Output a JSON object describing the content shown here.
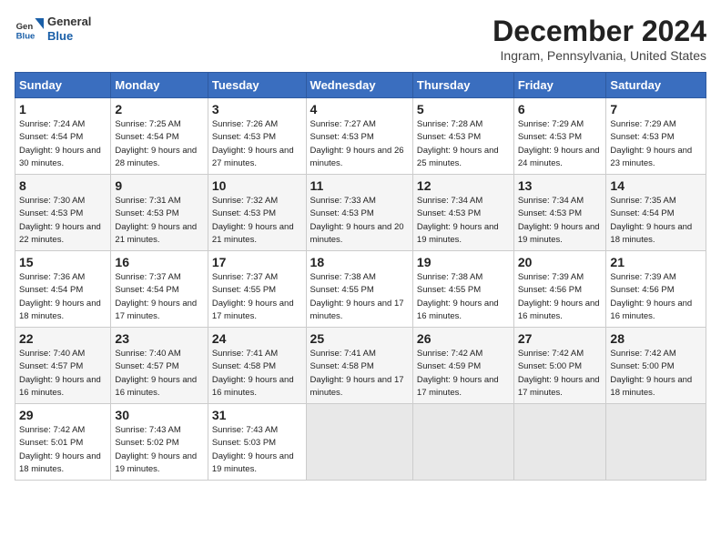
{
  "header": {
    "logo_line1": "General",
    "logo_line2": "Blue",
    "month_title": "December 2024",
    "location": "Ingram, Pennsylvania, United States"
  },
  "weekdays": [
    "Sunday",
    "Monday",
    "Tuesday",
    "Wednesday",
    "Thursday",
    "Friday",
    "Saturday"
  ],
  "weeks": [
    [
      {
        "day": "1",
        "sunrise": "7:24 AM",
        "sunset": "4:54 PM",
        "daylight": "9 hours and 30 minutes."
      },
      {
        "day": "2",
        "sunrise": "7:25 AM",
        "sunset": "4:54 PM",
        "daylight": "9 hours and 28 minutes."
      },
      {
        "day": "3",
        "sunrise": "7:26 AM",
        "sunset": "4:53 PM",
        "daylight": "9 hours and 27 minutes."
      },
      {
        "day": "4",
        "sunrise": "7:27 AM",
        "sunset": "4:53 PM",
        "daylight": "9 hours and 26 minutes."
      },
      {
        "day": "5",
        "sunrise": "7:28 AM",
        "sunset": "4:53 PM",
        "daylight": "9 hours and 25 minutes."
      },
      {
        "day": "6",
        "sunrise": "7:29 AM",
        "sunset": "4:53 PM",
        "daylight": "9 hours and 24 minutes."
      },
      {
        "day": "7",
        "sunrise": "7:29 AM",
        "sunset": "4:53 PM",
        "daylight": "9 hours and 23 minutes."
      }
    ],
    [
      {
        "day": "8",
        "sunrise": "7:30 AM",
        "sunset": "4:53 PM",
        "daylight": "9 hours and 22 minutes."
      },
      {
        "day": "9",
        "sunrise": "7:31 AM",
        "sunset": "4:53 PM",
        "daylight": "9 hours and 21 minutes."
      },
      {
        "day": "10",
        "sunrise": "7:32 AM",
        "sunset": "4:53 PM",
        "daylight": "9 hours and 21 minutes."
      },
      {
        "day": "11",
        "sunrise": "7:33 AM",
        "sunset": "4:53 PM",
        "daylight": "9 hours and 20 minutes."
      },
      {
        "day": "12",
        "sunrise": "7:34 AM",
        "sunset": "4:53 PM",
        "daylight": "9 hours and 19 minutes."
      },
      {
        "day": "13",
        "sunrise": "7:34 AM",
        "sunset": "4:53 PM",
        "daylight": "9 hours and 19 minutes."
      },
      {
        "day": "14",
        "sunrise": "7:35 AM",
        "sunset": "4:54 PM",
        "daylight": "9 hours and 18 minutes."
      }
    ],
    [
      {
        "day": "15",
        "sunrise": "7:36 AM",
        "sunset": "4:54 PM",
        "daylight": "9 hours and 18 minutes."
      },
      {
        "day": "16",
        "sunrise": "7:37 AM",
        "sunset": "4:54 PM",
        "daylight": "9 hours and 17 minutes."
      },
      {
        "day": "17",
        "sunrise": "7:37 AM",
        "sunset": "4:55 PM",
        "daylight": "9 hours and 17 minutes."
      },
      {
        "day": "18",
        "sunrise": "7:38 AM",
        "sunset": "4:55 PM",
        "daylight": "9 hours and 17 minutes."
      },
      {
        "day": "19",
        "sunrise": "7:38 AM",
        "sunset": "4:55 PM",
        "daylight": "9 hours and 16 minutes."
      },
      {
        "day": "20",
        "sunrise": "7:39 AM",
        "sunset": "4:56 PM",
        "daylight": "9 hours and 16 minutes."
      },
      {
        "day": "21",
        "sunrise": "7:39 AM",
        "sunset": "4:56 PM",
        "daylight": "9 hours and 16 minutes."
      }
    ],
    [
      {
        "day": "22",
        "sunrise": "7:40 AM",
        "sunset": "4:57 PM",
        "daylight": "9 hours and 16 minutes."
      },
      {
        "day": "23",
        "sunrise": "7:40 AM",
        "sunset": "4:57 PM",
        "daylight": "9 hours and 16 minutes."
      },
      {
        "day": "24",
        "sunrise": "7:41 AM",
        "sunset": "4:58 PM",
        "daylight": "9 hours and 16 minutes."
      },
      {
        "day": "25",
        "sunrise": "7:41 AM",
        "sunset": "4:58 PM",
        "daylight": "9 hours and 17 minutes."
      },
      {
        "day": "26",
        "sunrise": "7:42 AM",
        "sunset": "4:59 PM",
        "daylight": "9 hours and 17 minutes."
      },
      {
        "day": "27",
        "sunrise": "7:42 AM",
        "sunset": "5:00 PM",
        "daylight": "9 hours and 17 minutes."
      },
      {
        "day": "28",
        "sunrise": "7:42 AM",
        "sunset": "5:00 PM",
        "daylight": "9 hours and 18 minutes."
      }
    ],
    [
      {
        "day": "29",
        "sunrise": "7:42 AM",
        "sunset": "5:01 PM",
        "daylight": "9 hours and 18 minutes."
      },
      {
        "day": "30",
        "sunrise": "7:43 AM",
        "sunset": "5:02 PM",
        "daylight": "9 hours and 19 minutes."
      },
      {
        "day": "31",
        "sunrise": "7:43 AM",
        "sunset": "5:03 PM",
        "daylight": "9 hours and 19 minutes."
      },
      null,
      null,
      null,
      null
    ]
  ]
}
